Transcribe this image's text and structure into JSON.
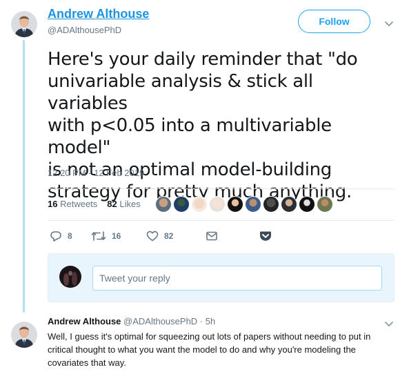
{
  "tweet": {
    "author_name": "Andrew Althouse",
    "author_handle": "@ADAlthousePhD",
    "follow_label": "Follow",
    "text_lines": [
      "Here's your daily reminder that \"do",
      "univariable analysis & stick all variables",
      "with p<0.05 into a multivariable model\"",
      "is not an optimal model-building",
      "strategy for pretty much anything."
    ],
    "timestamp": "12:20 PM - 12 Feb 2019",
    "retweets_count": "16",
    "retweets_label": "Retweets",
    "likes_count": "82",
    "likes_label": "Likes",
    "liker_count": 10,
    "actions": {
      "reply_count": "8",
      "retweet_count": "16",
      "like_count": "82"
    },
    "icons": {
      "reply": "reply-icon",
      "retweet": "retweet-icon",
      "like": "heart-icon",
      "message": "envelope-icon",
      "save": "pocket-icon",
      "more": "chevron-down-icon"
    }
  },
  "reply_composer": {
    "placeholder": "Tweet your reply"
  },
  "reply": {
    "author_name": "Andrew Althouse",
    "author_handle": "@ADAlthousePhD",
    "separator": "·",
    "time": "5h",
    "text": "Well, I guess it's optimal for squeezing out lots of papers without needing to put in critical thought to what you want the model to do and why you're modeling the covariates that way."
  },
  "colors": {
    "accent": "#1da1f2",
    "link": "#1b95e0",
    "thread_line": "#b3def6",
    "muted": "#657786",
    "composer_bg": "#e8f5fd",
    "pocket": "#3c4a57"
  }
}
